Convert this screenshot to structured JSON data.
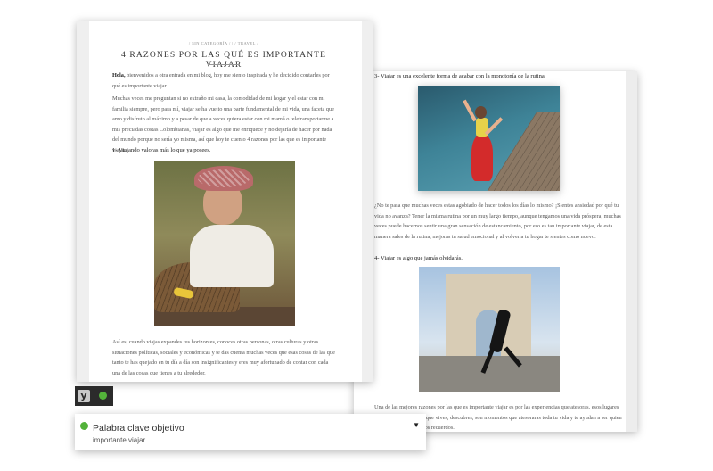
{
  "post": {
    "categories": "/ SIN CATEGORÍA / | / TRAVEL /",
    "title": "4 RAZONES POR LAS QUÉ ES IMPORTANTE VIAJAR",
    "intro_bold": "Hola,",
    "intro_rest": " bienvenidos a otra entrada en mi blog, hoy me siento inspirada y he decidido contarles por qué es importante viajar.",
    "paragraph_1": "Muchas veces me preguntan si no extraño mi casa, la comodidad de mi hogar y el estar con mi familia siempre, pero para mí, viajar se ha vuelto una parte fundamental de mi vida, una faceta que amo y disfruto al máximo y a pesar de que a veces quiera estar con mi mamá o teletransportarme a mis preciadas costas Colombianas, viajar es algo que me enriquece y no dejaría de hacer por nada del mundo porque no sería yo misma, así que hoy te cuento 4 razones por las que es importante viajar.",
    "heading_1": "1- Viajando valoras más lo que ya posees.",
    "paragraph_2": "Así es, cuando viajas expandes tus horizontes, conoces otras personas, otras culturas y otras situaciones políticas, sociales y económicas y te das cuenta muchas veces que esas cosas de las que tanto te has quejado en tu día a día son insignificantes y eres muy afortunado de contar con cada una de las cosas que tienes a tu alrededor.",
    "heading_3": "3- Viajar es una excelente forma de acabar con la monotonía de la rutina.",
    "paragraph_3": "¿No te pasa que muchas veces estas agobiado de hacer todos los días lo mismo? ¡Sientes ansiedad por qué tu vida no avanza? Tener la misma rutina por un muy largo tiempo, aunque tengamos una vida próspera, muchas veces puede hacernos sentir una gran sensación de estancamiento, por eso es tan importante viajar, de esta manera sales de la rutina, mejoras tu salud emocional y al volver a tu hogar te sientes como nuevo.",
    "heading_4": "4- Viajar es algo que jamás olvidarás.",
    "paragraph_4": "Una de las mejores razones por las que es importante viajar es por las experiencias que atesoras. esos lugares que conoces, las cosas que vives, descubres, son momentos que atesoraras toda tu vida y te ayudan a ser quien eres, a crear que vive los recuerdos."
  },
  "seo": {
    "logo_letter": "y",
    "keyword_label": "Palabra clave objetivo",
    "keyword_value": "importante viajar",
    "toggle_glyph": "▼",
    "status_color": "#53b23a"
  }
}
